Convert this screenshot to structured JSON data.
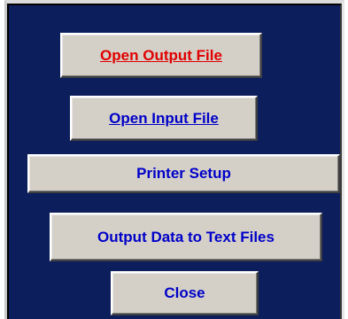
{
  "dialog": {
    "colors": {
      "background": "#0c1e5c",
      "button_face": "#d4d0c8",
      "label_primary": "#0000c8",
      "label_highlight": "#e00000"
    },
    "buttons": [
      {
        "label": "Open Output File",
        "underlined": true,
        "highlight": true
      },
      {
        "label": "Open Input File",
        "underlined": true,
        "highlight": false
      },
      {
        "label": "Printer Setup",
        "underlined": false,
        "highlight": false
      },
      {
        "label": "Output Data to Text Files",
        "underlined": false,
        "highlight": false
      },
      {
        "label": "Close",
        "underlined": false,
        "highlight": false
      }
    ]
  }
}
